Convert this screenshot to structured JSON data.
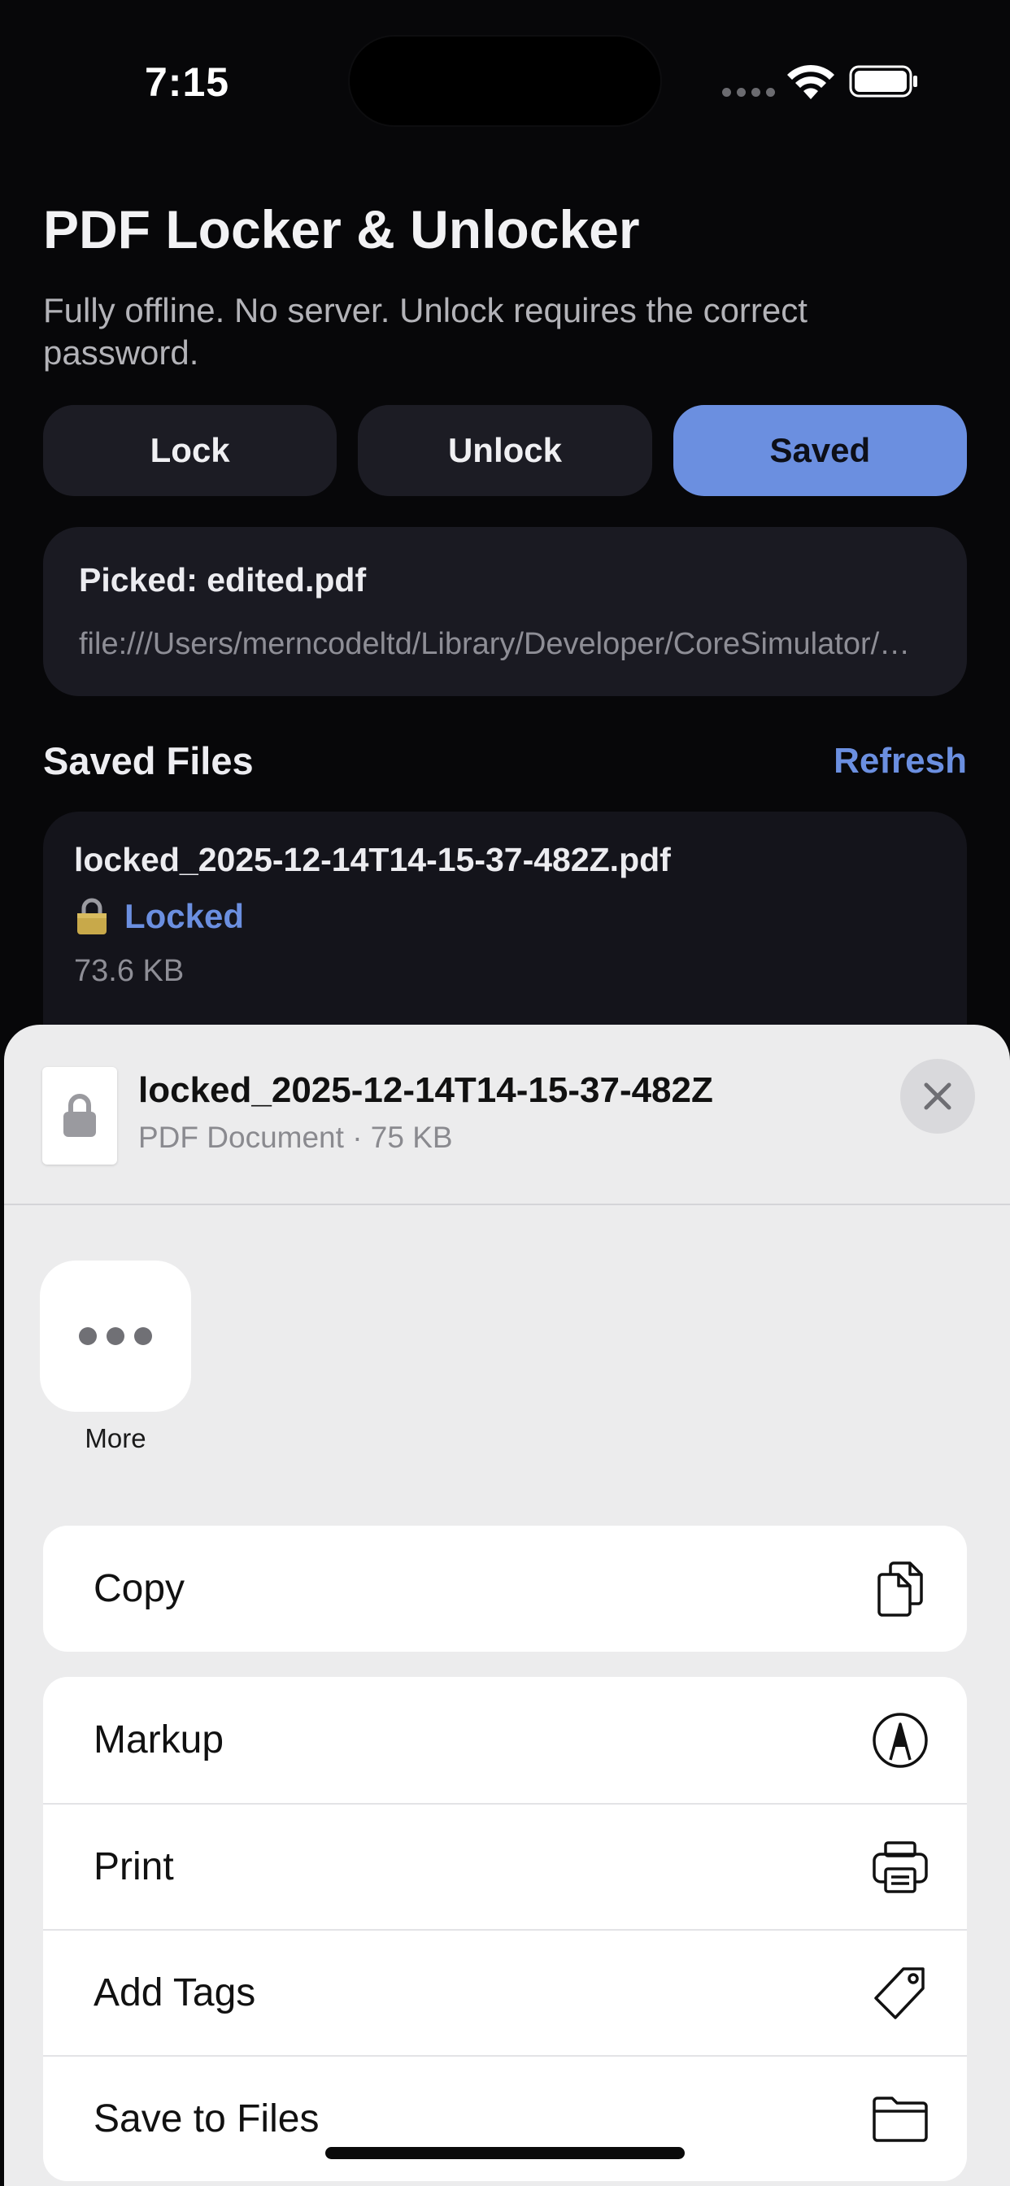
{
  "status_bar": {
    "time": "7:15"
  },
  "app": {
    "title": "PDF Locker & Unlocker",
    "subtitle": "Fully offline. No server. Unlock requires the correct password.",
    "tabs": [
      {
        "label": "Lock",
        "active": false
      },
      {
        "label": "Unlock",
        "active": false
      },
      {
        "label": "Saved",
        "active": true
      }
    ],
    "picked": {
      "name": "Picked: edited.pdf",
      "path": "file:///Users/merncodeltd/Library/Developer/CoreSimulator/Devices/…"
    },
    "saved_section": {
      "title": "Saved Files",
      "refresh_label": "Refresh"
    },
    "saved_files": [
      {
        "name": "locked_2025-12-14T14-15-37-482Z.pdf",
        "status": "Locked",
        "size": "73.6 KB"
      }
    ]
  },
  "share_sheet": {
    "doc_title": "locked_2025-12-14T14-15-37-482Z",
    "doc_subtitle": "PDF Document · 75 KB",
    "more_label": "More",
    "groups": [
      [
        {
          "label": "Copy",
          "icon": "copy-icon"
        }
      ],
      [
        {
          "label": "Markup",
          "icon": "markup-icon"
        },
        {
          "label": "Print",
          "icon": "printer-icon"
        },
        {
          "label": "Add Tags",
          "icon": "tag-icon"
        },
        {
          "label": "Save to Files",
          "icon": "folder-icon"
        }
      ]
    ]
  },
  "colors": {
    "accent": "#6b8fe0",
    "background": "#070709",
    "card": "#1a1a22",
    "sheet": "#ececed"
  }
}
